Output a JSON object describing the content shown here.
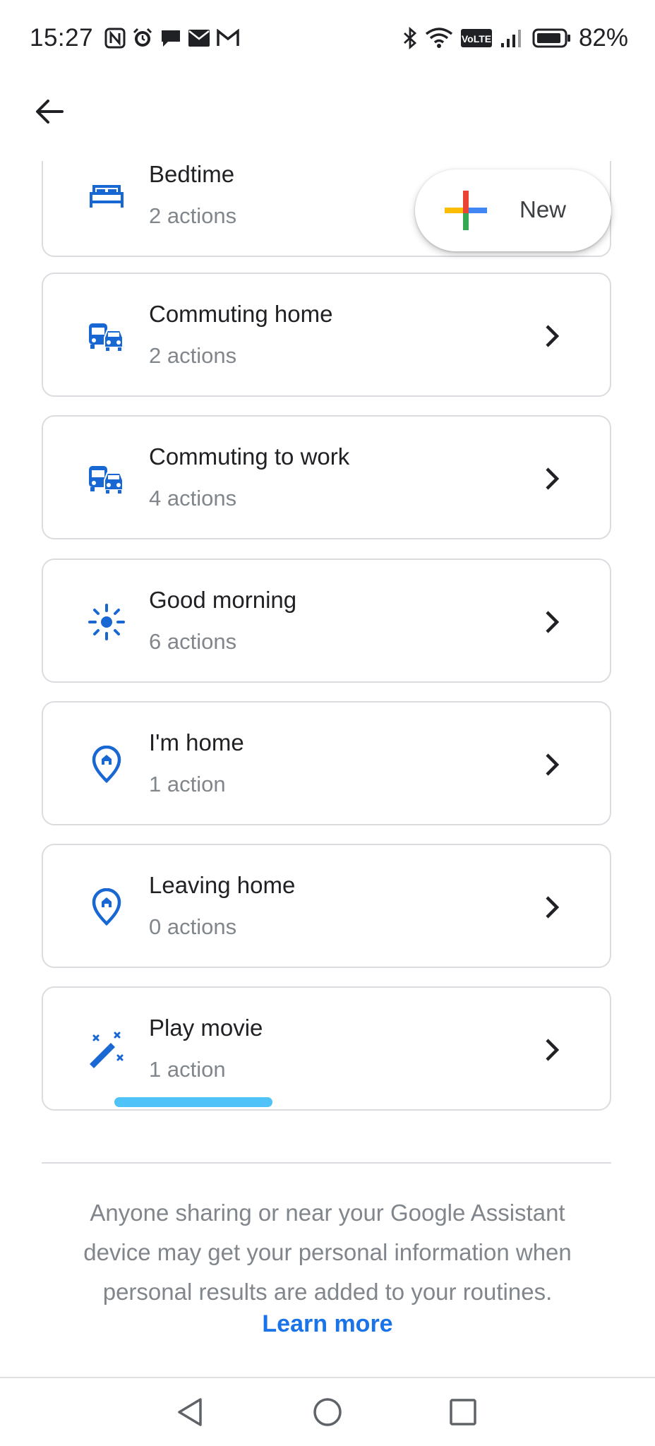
{
  "status_bar": {
    "time": "15:27",
    "battery_percent": "82%",
    "left_icons": [
      "nfc-icon",
      "alarm-icon",
      "chat-icon",
      "mail-icon",
      "gmail-icon"
    ],
    "right_icons": [
      "bluetooth-icon",
      "wifi-icon",
      "volte-icon",
      "signal-icon",
      "battery-icon"
    ],
    "volte_label": "VoLTE"
  },
  "header": {
    "back_icon": "arrow-back-icon"
  },
  "fab": {
    "label": "New",
    "icon": "google-plus-icon",
    "colors": [
      "#ea4335",
      "#4285f4",
      "#34a853",
      "#fbbc04"
    ]
  },
  "routines": [
    {
      "title": "Bedtime",
      "subtitle": "2 actions",
      "icon": "bed-icon"
    },
    {
      "title": "Commuting home",
      "subtitle": "2 actions",
      "icon": "commute-icon"
    },
    {
      "title": "Commuting to work",
      "subtitle": "4 actions",
      "icon": "commute-icon"
    },
    {
      "title": "Good morning",
      "subtitle": "6 actions",
      "icon": "sun-icon"
    },
    {
      "title": "I'm home",
      "subtitle": "1 action",
      "icon": "home-pin-icon"
    },
    {
      "title": "Leaving home",
      "subtitle": "0 actions",
      "icon": "home-pin-icon"
    },
    {
      "title": "Play movie",
      "subtitle": "1 action",
      "icon": "magic-wand-icon"
    }
  ],
  "footer": {
    "line1": "Anyone sharing or near your Google Assistant",
    "line2": "device may get your personal information when",
    "line3": "personal results are added to your routines.",
    "learn_more": "Learn more"
  },
  "nav_bar": {
    "buttons": [
      "back-triangle-icon",
      "home-circle-icon",
      "recents-square-icon"
    ]
  },
  "colors": {
    "accent_blue": "#1a73e8",
    "icon_blue": "#1967d2",
    "subtitle_gray": "#80868b",
    "border_gray": "#dadce0",
    "progress_cyan": "#4fc3f7"
  }
}
